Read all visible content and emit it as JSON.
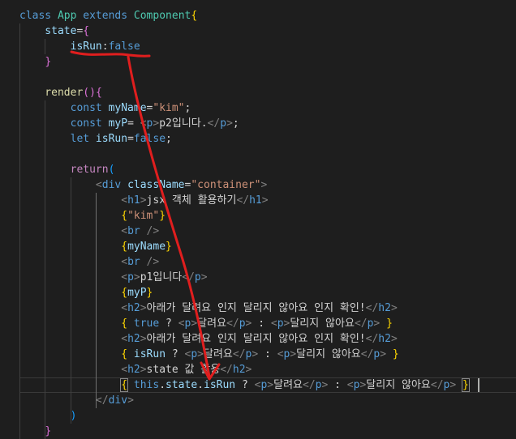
{
  "colors": {
    "background": "#1e1e1e",
    "keyword": "#569cd6",
    "control": "#c586c0",
    "class_name": "#4ec9b0",
    "variable": "#9cdcfe",
    "string": "#ce9178",
    "function": "#dcdcaa",
    "plain": "#d4d4d4",
    "tag_bracket": "#808080",
    "bracket_gold": "#ffd700",
    "bracket_purple": "#da70d6",
    "bracket_blue": "#179fff",
    "annotation": "#e01e1e"
  },
  "annotation": {
    "description_icon": "red-hand-drawn-arrow"
  },
  "code_lines": [
    [
      {
        "t": "class ",
        "c": "keyword"
      },
      {
        "t": "App ",
        "c": "class_name"
      },
      {
        "t": "extends ",
        "c": "keyword"
      },
      {
        "t": "Component",
        "c": "class_name"
      },
      {
        "t": "{",
        "c": "bracket_gold"
      }
    ],
    [
      {
        "t": "    state",
        "c": "variable"
      },
      {
        "t": "=",
        "c": "plain"
      },
      {
        "t": "{",
        "c": "bracket_purple"
      }
    ],
    [
      {
        "t": "        isRun",
        "c": "variable"
      },
      {
        "t": ":",
        "c": "plain"
      },
      {
        "t": "false",
        "c": "keyword"
      }
    ],
    [
      {
        "t": "    ",
        "c": "plain"
      },
      {
        "t": "}",
        "c": "bracket_purple"
      }
    ],
    [
      {
        "t": "",
        "c": "plain"
      }
    ],
    [
      {
        "t": "    render",
        "c": "function"
      },
      {
        "t": "()",
        "c": "bracket_purple"
      },
      {
        "t": "{",
        "c": "bracket_purple"
      }
    ],
    [
      {
        "t": "        const ",
        "c": "keyword"
      },
      {
        "t": "myName",
        "c": "variable"
      },
      {
        "t": "=",
        "c": "plain"
      },
      {
        "t": "\"kim\"",
        "c": "string"
      },
      {
        "t": ";",
        "c": "plain"
      }
    ],
    [
      {
        "t": "        const ",
        "c": "keyword"
      },
      {
        "t": "myP",
        "c": "variable"
      },
      {
        "t": "= ",
        "c": "plain"
      },
      {
        "t": "<",
        "c": "tag_bracket"
      },
      {
        "t": "p",
        "c": "keyword"
      },
      {
        "t": ">",
        "c": "tag_bracket"
      },
      {
        "t": "p2입니다.",
        "c": "plain"
      },
      {
        "t": "</",
        "c": "tag_bracket"
      },
      {
        "t": "p",
        "c": "keyword"
      },
      {
        "t": ">",
        "c": "tag_bracket"
      },
      {
        "t": ";",
        "c": "plain"
      }
    ],
    [
      {
        "t": "        let ",
        "c": "keyword"
      },
      {
        "t": "isRun",
        "c": "variable"
      },
      {
        "t": "=",
        "c": "plain"
      },
      {
        "t": "false",
        "c": "keyword"
      },
      {
        "t": ";",
        "c": "plain"
      }
    ],
    [
      {
        "t": "",
        "c": "plain"
      }
    ],
    [
      {
        "t": "        return",
        "c": "control"
      },
      {
        "t": "(",
        "c": "bracket_blue"
      }
    ],
    [
      {
        "t": "            ",
        "c": "plain"
      },
      {
        "t": "<",
        "c": "tag_bracket"
      },
      {
        "t": "div ",
        "c": "keyword"
      },
      {
        "t": "className",
        "c": "variable"
      },
      {
        "t": "=",
        "c": "plain"
      },
      {
        "t": "\"container\"",
        "c": "string"
      },
      {
        "t": ">",
        "c": "tag_bracket"
      }
    ],
    [
      {
        "t": "                ",
        "c": "plain"
      },
      {
        "t": "<",
        "c": "tag_bracket"
      },
      {
        "t": "h1",
        "c": "keyword"
      },
      {
        "t": ">",
        "c": "tag_bracket"
      },
      {
        "t": "jsx 객체 활용하기",
        "c": "plain"
      },
      {
        "t": "</",
        "c": "tag_bracket"
      },
      {
        "t": "h1",
        "c": "keyword"
      },
      {
        "t": ">",
        "c": "tag_bracket"
      }
    ],
    [
      {
        "t": "                ",
        "c": "plain"
      },
      {
        "t": "{",
        "c": "bracket_gold"
      },
      {
        "t": "\"kim\"",
        "c": "string"
      },
      {
        "t": "}",
        "c": "bracket_gold"
      }
    ],
    [
      {
        "t": "                ",
        "c": "plain"
      },
      {
        "t": "<",
        "c": "tag_bracket"
      },
      {
        "t": "br ",
        "c": "keyword"
      },
      {
        "t": "/>",
        "c": "tag_bracket"
      }
    ],
    [
      {
        "t": "                ",
        "c": "plain"
      },
      {
        "t": "{",
        "c": "bracket_gold"
      },
      {
        "t": "myName",
        "c": "variable"
      },
      {
        "t": "}",
        "c": "bracket_gold"
      }
    ],
    [
      {
        "t": "                ",
        "c": "plain"
      },
      {
        "t": "<",
        "c": "tag_bracket"
      },
      {
        "t": "br ",
        "c": "keyword"
      },
      {
        "t": "/>",
        "c": "tag_bracket"
      }
    ],
    [
      {
        "t": "                ",
        "c": "plain"
      },
      {
        "t": "<",
        "c": "tag_bracket"
      },
      {
        "t": "p",
        "c": "keyword"
      },
      {
        "t": ">",
        "c": "tag_bracket"
      },
      {
        "t": "p1입니다",
        "c": "plain"
      },
      {
        "t": "</",
        "c": "tag_bracket"
      },
      {
        "t": "p",
        "c": "keyword"
      },
      {
        "t": ">",
        "c": "tag_bracket"
      }
    ],
    [
      {
        "t": "                ",
        "c": "plain"
      },
      {
        "t": "{",
        "c": "bracket_gold"
      },
      {
        "t": "myP",
        "c": "variable"
      },
      {
        "t": "}",
        "c": "bracket_gold"
      }
    ],
    [
      {
        "t": "                ",
        "c": "plain"
      },
      {
        "t": "<",
        "c": "tag_bracket"
      },
      {
        "t": "h2",
        "c": "keyword"
      },
      {
        "t": ">",
        "c": "tag_bracket"
      },
      {
        "t": "아래가 달려요 인지 달리지 않아요 인지 확인!",
        "c": "plain"
      },
      {
        "t": "</",
        "c": "tag_bracket"
      },
      {
        "t": "h2",
        "c": "keyword"
      },
      {
        "t": ">",
        "c": "tag_bracket"
      }
    ],
    [
      {
        "t": "                ",
        "c": "plain"
      },
      {
        "t": "{",
        "c": "bracket_gold"
      },
      {
        "t": " true ",
        "c": "keyword"
      },
      {
        "t": "? ",
        "c": "plain"
      },
      {
        "t": "<",
        "c": "tag_bracket"
      },
      {
        "t": "p",
        "c": "keyword"
      },
      {
        "t": ">",
        "c": "tag_bracket"
      },
      {
        "t": "달려요",
        "c": "plain"
      },
      {
        "t": "</",
        "c": "tag_bracket"
      },
      {
        "t": "p",
        "c": "keyword"
      },
      {
        "t": ">",
        "c": "tag_bracket"
      },
      {
        "t": " : ",
        "c": "plain"
      },
      {
        "t": "<",
        "c": "tag_bracket"
      },
      {
        "t": "p",
        "c": "keyword"
      },
      {
        "t": ">",
        "c": "tag_bracket"
      },
      {
        "t": "달리지 않아요",
        "c": "plain"
      },
      {
        "t": "</",
        "c": "tag_bracket"
      },
      {
        "t": "p",
        "c": "keyword"
      },
      {
        "t": ">",
        "c": "tag_bracket"
      },
      {
        "t": " }",
        "c": "bracket_gold"
      }
    ],
    [
      {
        "t": "                ",
        "c": "plain"
      },
      {
        "t": "<",
        "c": "tag_bracket"
      },
      {
        "t": "h2",
        "c": "keyword"
      },
      {
        "t": ">",
        "c": "tag_bracket"
      },
      {
        "t": "아래가 달려요 인지 달리지 않아요 인지 확인!",
        "c": "plain"
      },
      {
        "t": "</",
        "c": "tag_bracket"
      },
      {
        "t": "h2",
        "c": "keyword"
      },
      {
        "t": ">",
        "c": "tag_bracket"
      }
    ],
    [
      {
        "t": "                ",
        "c": "plain"
      },
      {
        "t": "{",
        "c": "bracket_gold"
      },
      {
        "t": " isRun ",
        "c": "variable"
      },
      {
        "t": "? ",
        "c": "plain"
      },
      {
        "t": "<",
        "c": "tag_bracket"
      },
      {
        "t": "p",
        "c": "keyword"
      },
      {
        "t": ">",
        "c": "tag_bracket"
      },
      {
        "t": "달려요",
        "c": "plain"
      },
      {
        "t": "</",
        "c": "tag_bracket"
      },
      {
        "t": "p",
        "c": "keyword"
      },
      {
        "t": ">",
        "c": "tag_bracket"
      },
      {
        "t": " : ",
        "c": "plain"
      },
      {
        "t": "<",
        "c": "tag_bracket"
      },
      {
        "t": "p",
        "c": "keyword"
      },
      {
        "t": ">",
        "c": "tag_bracket"
      },
      {
        "t": "달리지 않아요",
        "c": "plain"
      },
      {
        "t": "</",
        "c": "tag_bracket"
      },
      {
        "t": "p",
        "c": "keyword"
      },
      {
        "t": ">",
        "c": "tag_bracket"
      },
      {
        "t": " }",
        "c": "bracket_gold"
      }
    ],
    [
      {
        "t": "                ",
        "c": "plain"
      },
      {
        "t": "<",
        "c": "tag_bracket"
      },
      {
        "t": "h2",
        "c": "keyword"
      },
      {
        "t": ">",
        "c": "tag_bracket"
      },
      {
        "t": "state 값 활용",
        "c": "plain"
      },
      {
        "t": "</",
        "c": "tag_bracket"
      },
      {
        "t": "h2",
        "c": "keyword"
      },
      {
        "t": ">",
        "c": "tag_bracket"
      }
    ],
    [
      {
        "t": "                ",
        "c": "plain"
      },
      {
        "t": "{",
        "c": "bracket_gold"
      },
      {
        "t": " this",
        "c": "keyword"
      },
      {
        "t": ".",
        "c": "plain"
      },
      {
        "t": "state",
        "c": "variable"
      },
      {
        "t": ".",
        "c": "plain"
      },
      {
        "t": "isRun ",
        "c": "variable"
      },
      {
        "t": "? ",
        "c": "plain"
      },
      {
        "t": "<",
        "c": "tag_bracket"
      },
      {
        "t": "p",
        "c": "keyword"
      },
      {
        "t": ">",
        "c": "tag_bracket"
      },
      {
        "t": "달려요",
        "c": "plain"
      },
      {
        "t": "</",
        "c": "tag_bracket"
      },
      {
        "t": "p",
        "c": "keyword"
      },
      {
        "t": ">",
        "c": "tag_bracket"
      },
      {
        "t": " : ",
        "c": "plain"
      },
      {
        "t": "<",
        "c": "tag_bracket"
      },
      {
        "t": "p",
        "c": "keyword"
      },
      {
        "t": ">",
        "c": "tag_bracket"
      },
      {
        "t": "달리지 않아요",
        "c": "plain"
      },
      {
        "t": "</",
        "c": "tag_bracket"
      },
      {
        "t": "p",
        "c": "keyword"
      },
      {
        "t": ">",
        "c": "tag_bracket"
      },
      {
        "t": " }",
        "c": "bracket_gold"
      }
    ],
    [
      {
        "t": "            ",
        "c": "plain"
      },
      {
        "t": "</",
        "c": "tag_bracket"
      },
      {
        "t": "div",
        "c": "keyword"
      },
      {
        "t": ">",
        "c": "tag_bracket"
      }
    ],
    [
      {
        "t": "        ",
        "c": "plain"
      },
      {
        "t": ")",
        "c": "bracket_blue"
      }
    ],
    [
      {
        "t": "    ",
        "c": "plain"
      },
      {
        "t": "}",
        "c": "bracket_purple"
      }
    ]
  ]
}
